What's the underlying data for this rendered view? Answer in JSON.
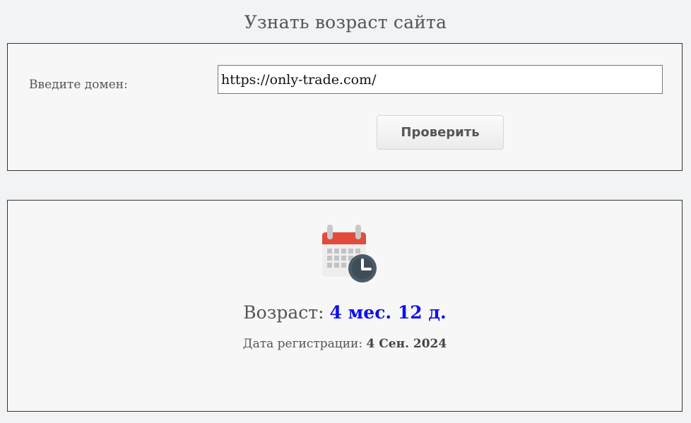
{
  "header": {
    "title": "Узнать возраст сайта"
  },
  "form": {
    "domain_label": "Введите домен:",
    "domain_value": "https://only-trade.com/",
    "submit_label": "Проверить"
  },
  "result": {
    "icon": "calendar-clock-icon",
    "age_label": "Возраст:",
    "age_value": "4 мес. 12 д.",
    "registration_label": "Дата регистрации:",
    "registration_date": "4 Сен. 2024"
  },
  "colors": {
    "age_value": "#1010e8",
    "calendar_header": "#e24b3c",
    "calendar_body": "#eeeeee",
    "clock_face": "#4b5a67"
  }
}
